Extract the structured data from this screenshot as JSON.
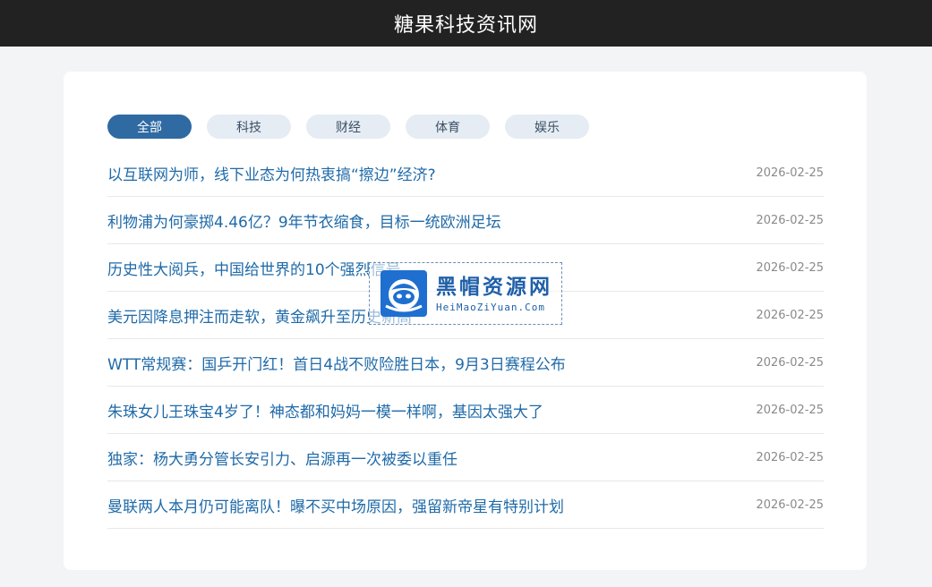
{
  "header": {
    "title": "糖果科技资讯网"
  },
  "tabs": [
    {
      "label": "全部",
      "active": true
    },
    {
      "label": "科技",
      "active": false
    },
    {
      "label": "财经",
      "active": false
    },
    {
      "label": "体育",
      "active": false
    },
    {
      "label": "娱乐",
      "active": false
    }
  ],
  "articles": [
    {
      "title": "以互联网为师，线下业态为何热衷搞“擦边”经济?",
      "date": "2026-02-25"
    },
    {
      "title": "利物浦为何豪掷4.46亿？9年节衣缩食，目标一统欧洲足坛",
      "date": "2026-02-25"
    },
    {
      "title": "历史性大阅兵，中国给世界的10个强烈信号",
      "date": "2026-02-25"
    },
    {
      "title": "美元因降息押注而走软，黄金飙升至历史新高",
      "date": "2026-02-25"
    },
    {
      "title": "WTT常规赛：国乒开门红！首日4战不败险胜日本，9月3日赛程公布",
      "date": "2026-02-25"
    },
    {
      "title": "朱珠女儿王珠宝4岁了！神态都和妈妈一模一样啊，基因太强大了",
      "date": "2026-02-25"
    },
    {
      "title": "独家：杨大勇分管长安引力、启源再一次被委以重任",
      "date": "2026-02-25"
    },
    {
      "title": "曼联两人本月仍可能离队！曝不买中场原因，强留新帝星有特别计划",
      "date": "2026-02-25"
    }
  ],
  "watermark": {
    "name_cn": "黑帽资源网",
    "name_en": "HeiMaoZiYuan.Com",
    "logo_icon": "hat-logo-icon"
  },
  "colors": {
    "header_bg": "#222222",
    "accent": "#2f6aa3",
    "link": "#1f6aa8",
    "tab_bg": "#e5ecf3"
  }
}
